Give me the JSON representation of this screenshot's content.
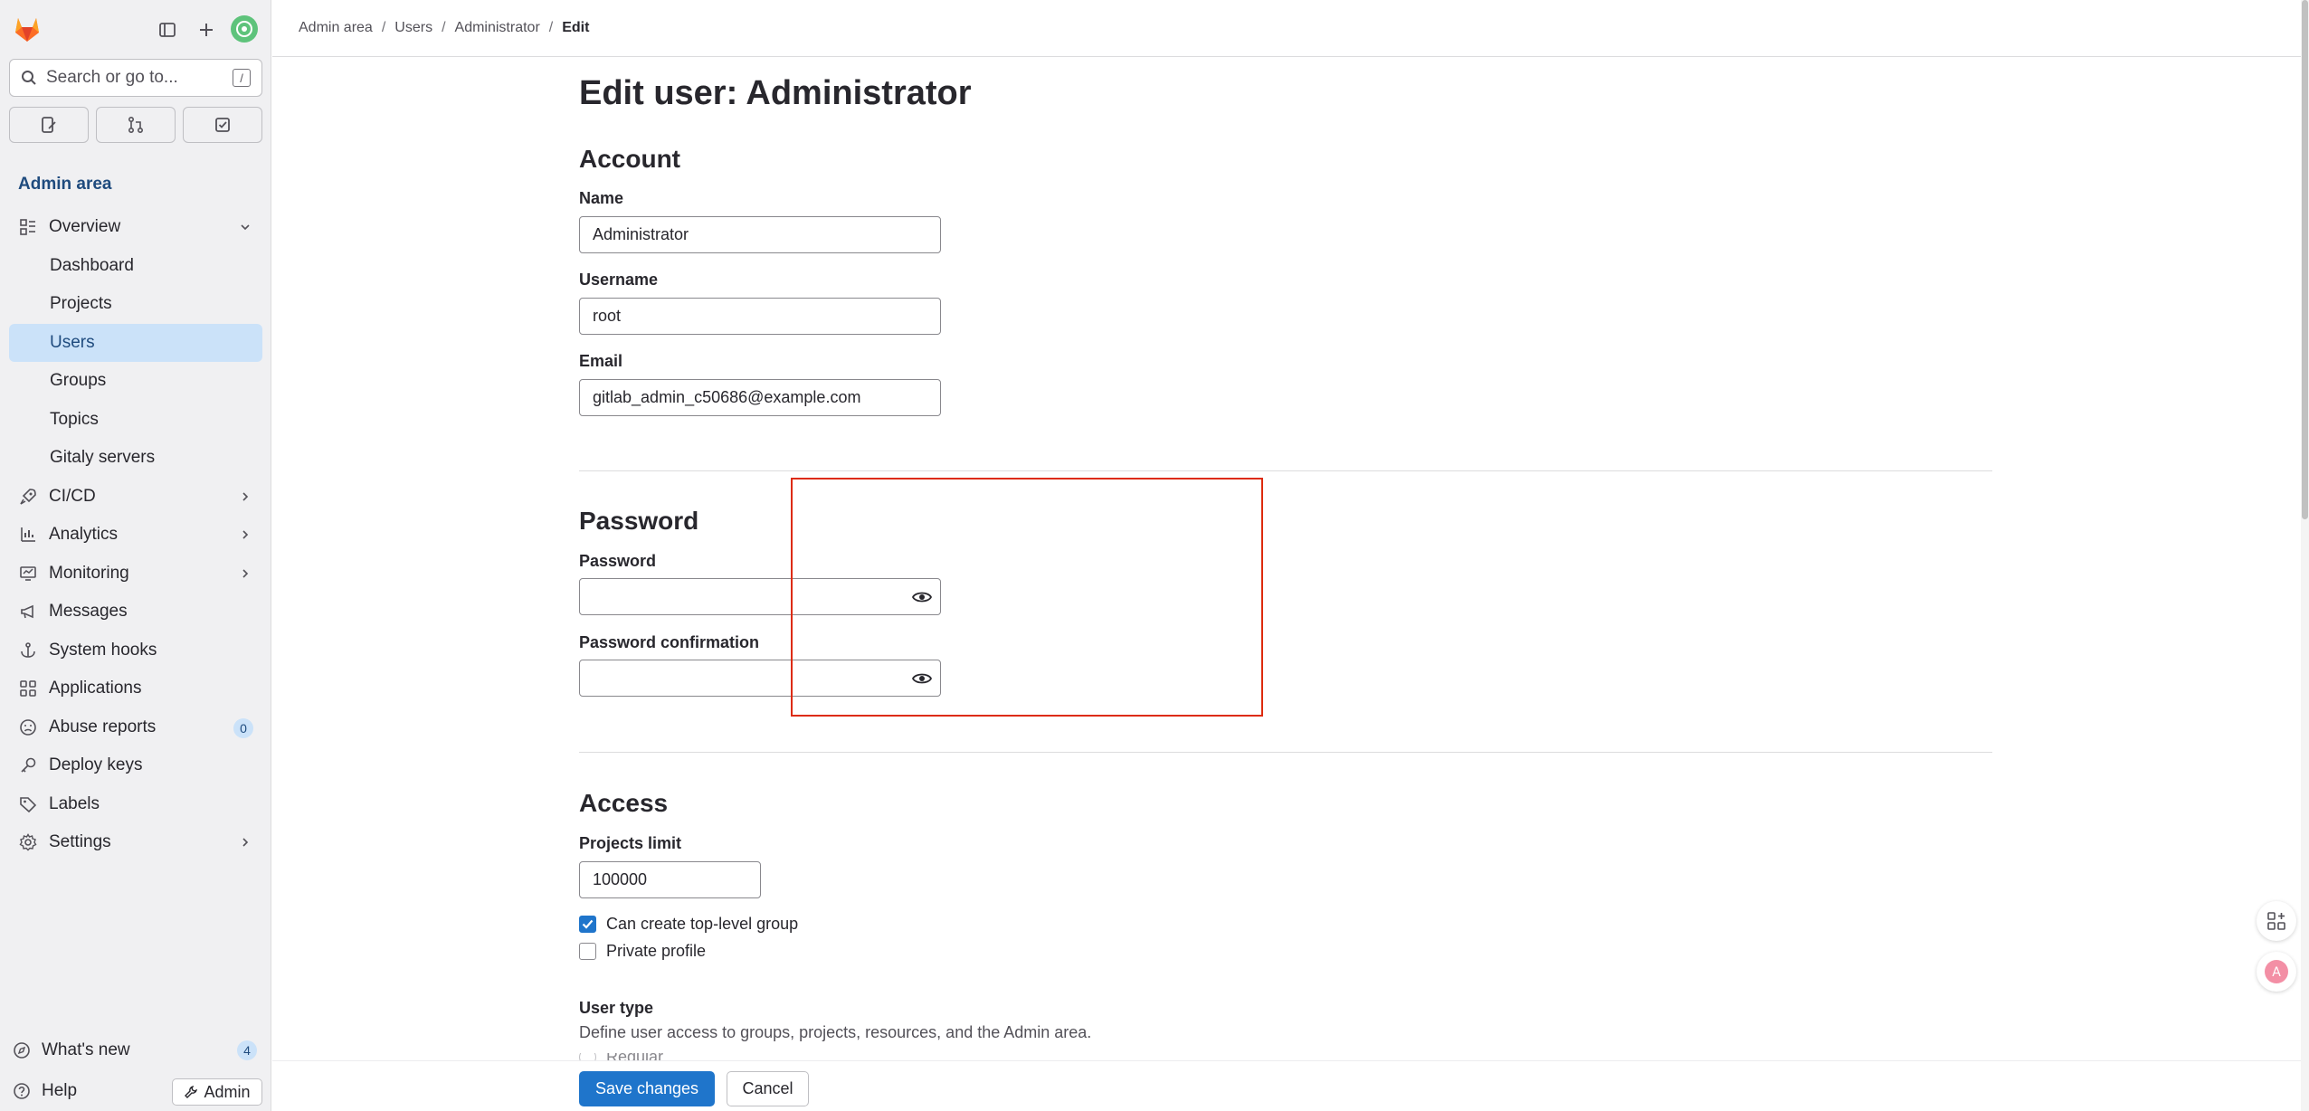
{
  "sidebar": {
    "search_placeholder": "Search or go to...",
    "search_shortcut": "/",
    "section_title": "Admin area",
    "items": [
      {
        "label": "Overview",
        "icon": "overview-icon",
        "expanded": true
      },
      {
        "label": "Dashboard",
        "sub": true
      },
      {
        "label": "Projects",
        "sub": true
      },
      {
        "label": "Users",
        "sub": true,
        "active": true
      },
      {
        "label": "Groups",
        "sub": true
      },
      {
        "label": "Topics",
        "sub": true
      },
      {
        "label": "Gitaly servers",
        "sub": true
      },
      {
        "label": "CI/CD",
        "icon": "rocket-icon"
      },
      {
        "label": "Analytics",
        "icon": "chart-icon"
      },
      {
        "label": "Monitoring",
        "icon": "monitor-icon"
      },
      {
        "label": "Messages",
        "icon": "megaphone-icon"
      },
      {
        "label": "System hooks",
        "icon": "anchor-icon"
      },
      {
        "label": "Applications",
        "icon": "applications-icon"
      },
      {
        "label": "Abuse reports",
        "icon": "abuse-icon",
        "badge": "0"
      },
      {
        "label": "Deploy keys",
        "icon": "key-icon"
      },
      {
        "label": "Labels",
        "icon": "label-icon"
      },
      {
        "label": "Settings",
        "icon": "gear-icon"
      }
    ],
    "whats_new": "What's new",
    "whats_new_count": "4",
    "help": "Help",
    "admin_button": "Admin"
  },
  "breadcrumb": [
    "Admin area",
    "Users",
    "Administrator",
    "Edit"
  ],
  "page": {
    "title": "Edit user: Administrator",
    "account": {
      "heading": "Account",
      "name_label": "Name",
      "name_value": "Administrator",
      "username_label": "Username",
      "username_value": "root",
      "email_label": "Email",
      "email_value": "gitlab_admin_c50686@example.com"
    },
    "password": {
      "heading": "Password",
      "password_label": "Password",
      "password_value": "",
      "confirmation_label": "Password confirmation",
      "confirmation_value": ""
    },
    "access": {
      "heading": "Access",
      "projects_limit_label": "Projects limit",
      "projects_limit_value": "100000",
      "can_create_group_label": "Can create top-level group",
      "can_create_group_checked": true,
      "private_profile_label": "Private profile",
      "private_profile_checked": false,
      "user_type_label": "User type",
      "user_type_description": "Define user access to groups, projects, resources, and the Admin area.",
      "user_type_first_option": "Regular"
    }
  },
  "footer": {
    "save_label": "Save changes",
    "cancel_label": "Cancel"
  },
  "colors": {
    "accent": "#1f75cb",
    "highlight": "#dd2b0e",
    "sidebar_bg": "#f0f0f2",
    "active_nav_bg": "#cbe2f9"
  }
}
